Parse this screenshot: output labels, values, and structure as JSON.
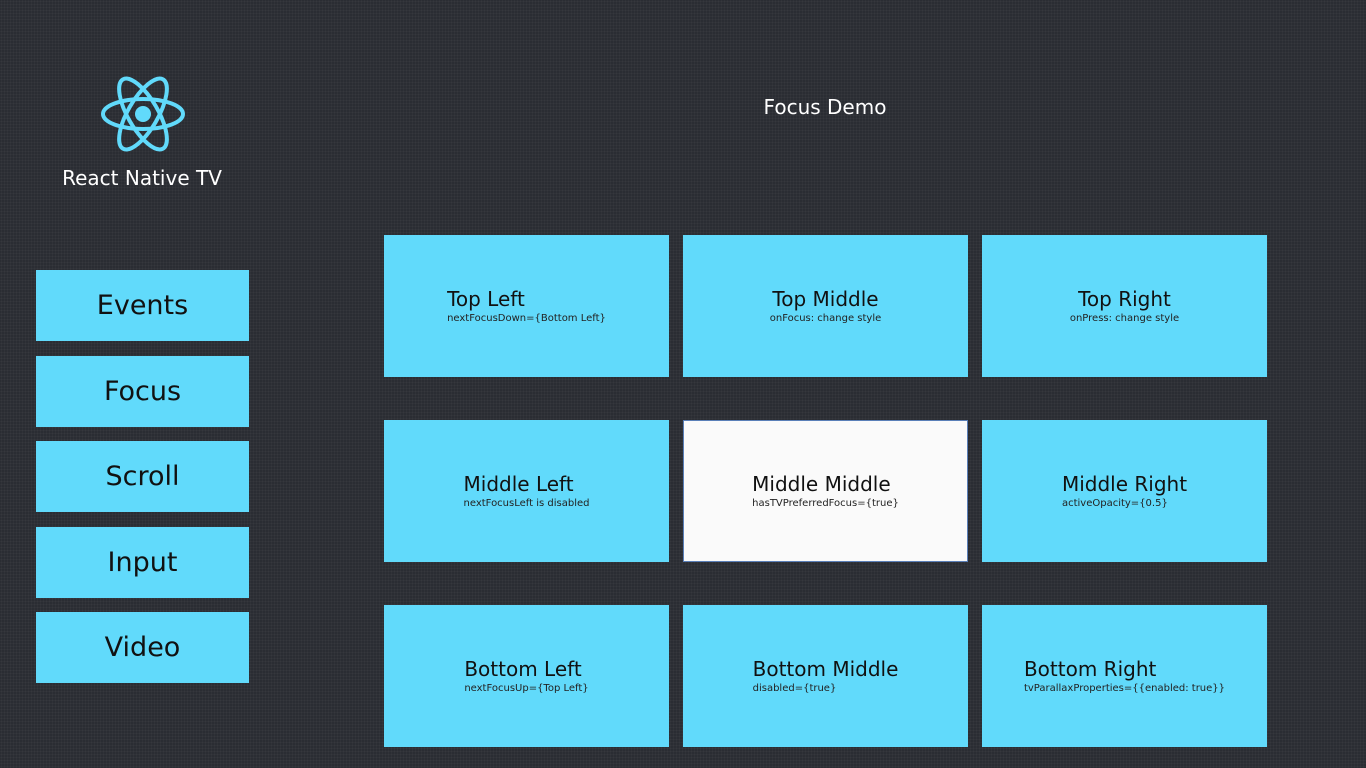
{
  "app": {
    "title": "React Native TV",
    "logo_icon": "react-atom-icon"
  },
  "page": {
    "title": "Focus Demo"
  },
  "sidebar": {
    "items": [
      {
        "label": "Events"
      },
      {
        "label": "Focus"
      },
      {
        "label": "Scroll"
      },
      {
        "label": "Input"
      },
      {
        "label": "Video"
      }
    ]
  },
  "grid": {
    "tiles": [
      {
        "title": "Top Left",
        "subtitle": "nextFocusDown={Bottom Left}"
      },
      {
        "title": "Top Middle",
        "subtitle": "onFocus: change style"
      },
      {
        "title": "Top Right",
        "subtitle": "onPress: change style"
      },
      {
        "title": "Middle Left",
        "subtitle": "nextFocusLeft is disabled"
      },
      {
        "title": "Middle Middle",
        "subtitle": "hasTVPreferredFocus={true}"
      },
      {
        "title": "Middle Right",
        "subtitle": "activeOpacity={0.5}"
      },
      {
        "title": "Bottom Left",
        "subtitle": "nextFocusUp={Top Left}"
      },
      {
        "title": "Bottom Middle",
        "subtitle": "disabled={true}"
      },
      {
        "title": "Bottom Right",
        "subtitle": "tvParallaxProperties={{enabled: true}}"
      }
    ]
  },
  "colors": {
    "background": "#2a2d33",
    "accent": "#61dafb",
    "focused_tile": "#fafafa",
    "text": "#ffffff"
  }
}
